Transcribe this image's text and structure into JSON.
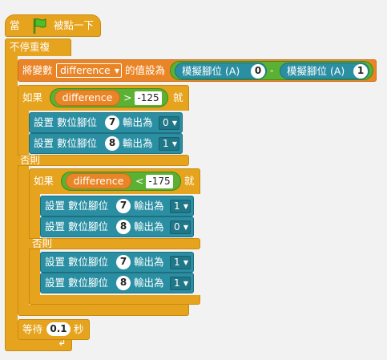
{
  "hat": {
    "when": "當",
    "clicked": "被點一下"
  },
  "forever": {
    "label": "不停重複"
  },
  "set_var": {
    "prefix": "將變數",
    "variable": "difference",
    "suffix": "的值設為",
    "sensor1": "模擬腳位 (A)",
    "pin1": "0",
    "minus": "-",
    "sensor2": "模擬腳位 (A)",
    "pin2": "1"
  },
  "if1": {
    "if": "如果",
    "var": "difference",
    "op": ">",
    "value": "-125",
    "then": "就",
    "set1": {
      "label": "設置 數位腳位",
      "pin": "7",
      "out": "輸出為",
      "val": "0"
    },
    "set2": {
      "label": "設置 數位腳位",
      "pin": "8",
      "out": "輸出為",
      "val": "1"
    },
    "else": "否則"
  },
  "if2": {
    "if": "如果",
    "var": "difference",
    "op": "<",
    "value": "-175",
    "then": "就",
    "set1": {
      "label": "設置 數位腳位",
      "pin": "7",
      "out": "輸出為",
      "val": "1"
    },
    "set2": {
      "label": "設置 數位腳位",
      "pin": "8",
      "out": "輸出為",
      "val": "0"
    },
    "else": "否則",
    "set3": {
      "label": "設置 數位腳位",
      "pin": "7",
      "out": "輸出為",
      "val": "1"
    },
    "set4": {
      "label": "設置 數位腳位",
      "pin": "8",
      "out": "輸出為",
      "val": "1"
    }
  },
  "wait": {
    "label": "等待",
    "value": "0.1",
    "unit": "秒"
  },
  "loop_arrow": "↲"
}
